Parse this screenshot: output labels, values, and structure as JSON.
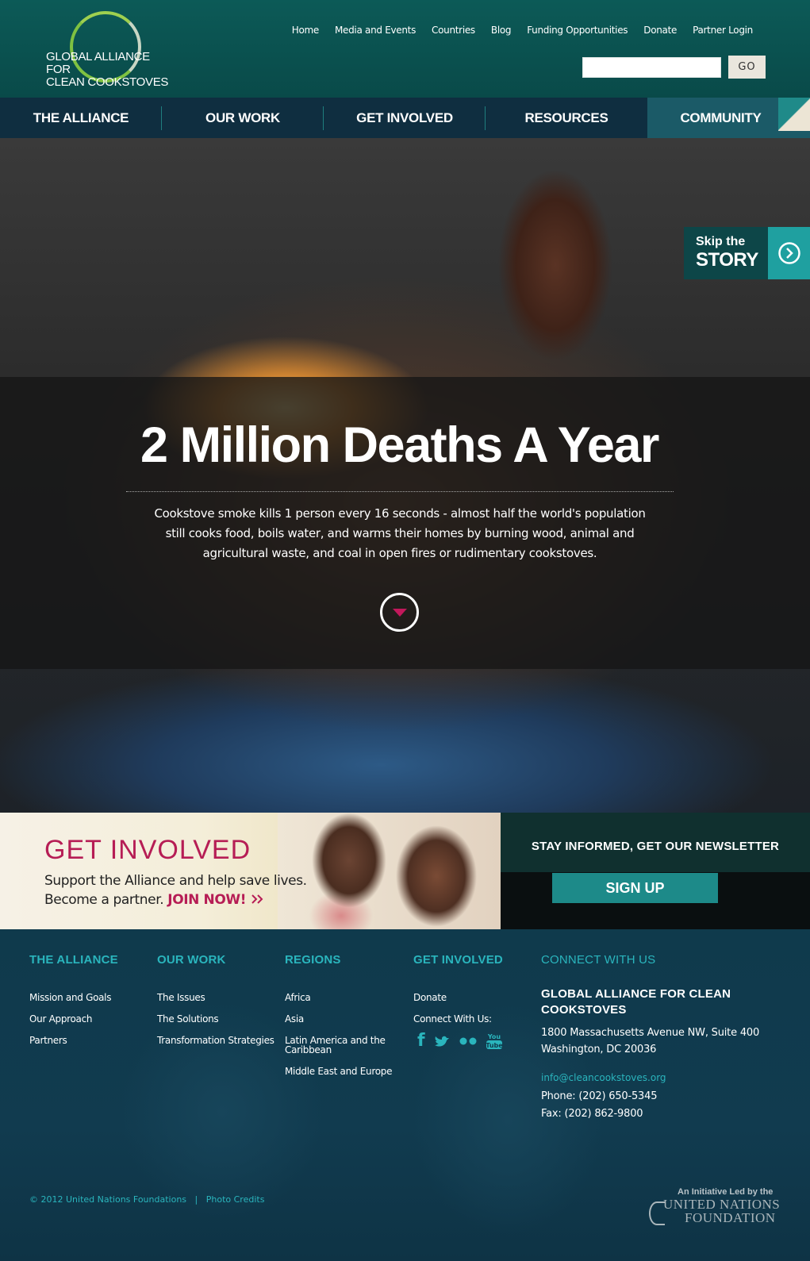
{
  "header": {
    "logo_line1": "GLOBAL ALLIANCE FOR",
    "logo_line2": "CLEAN COOKSTOVES",
    "top_nav": [
      "Home",
      "Media and Events",
      "Countries",
      "Blog",
      "Funding Opportunities",
      "Donate",
      "Partner Login"
    ],
    "search_value": "",
    "go_label": "GO"
  },
  "main_nav": [
    "THE ALLIANCE",
    "OUR WORK",
    "GET INVOLVED",
    "RESOURCES",
    "COMMUNITY"
  ],
  "hero": {
    "skip_small": "Skip the",
    "skip_big": "STORY",
    "headline": "2 Million Deaths A Year",
    "description": "Cookstove smoke kills 1 person every 16 seconds - almost half the world's population still cooks food, boils water, and warms their homes by burning wood, animal and agricultural waste, and coal in open fires or rudimentary cookstoves."
  },
  "get_involved": {
    "title": "GET INVOLVED",
    "line1": "Support the Alliance and help save lives.",
    "line2": "Become a partner.",
    "join": "JOIN NOW!"
  },
  "newsletter": {
    "title": "STAY INFORMED, GET OUR NEWSLETTER",
    "button": "SIGN UP"
  },
  "footer": {
    "alliance": {
      "heading": "THE ALLIANCE",
      "links": [
        "Mission and Goals",
        "Our Approach",
        "Partners"
      ]
    },
    "our_work": {
      "heading": "OUR WORK",
      "links": [
        "The Issues",
        "The Solutions",
        "Transformation Strategies"
      ]
    },
    "regions": {
      "heading": "REGIONS",
      "links": [
        "Africa",
        "Asia",
        "Latin America and the",
        "Caribbean",
        "Middle East and Europe"
      ]
    },
    "get_involved": {
      "heading": "GET INVOLVED",
      "links": [
        "Donate",
        "Connect With Us:"
      ]
    },
    "connect": {
      "heading": "CONNECT WITH US",
      "org_line1": "GLOBAL ALLIANCE FOR CLEAN",
      "org_line2": "COOKSTOVES",
      "address1": "1800 Massachusetts Avenue NW, Suite 400",
      "address2": "Washington, DC 20036",
      "email": "info@cleancookstoves.org",
      "phone": "Phone: (202) 650-5345",
      "fax": "Fax: (202) 862-9800"
    },
    "copyright": "© 2012 United Nations Foundations",
    "separator": "|",
    "photo_credits": "Photo Credits",
    "initiative": "An Initiative Led by the",
    "unf_line1": "UNITED NATIONS",
    "unf_line2": "FOUNDATION",
    "social_icons": [
      "facebook-icon",
      "twitter-icon",
      "flickr-icon",
      "youtube-icon"
    ],
    "social_youtube_top": "You",
    "social_youtube_bottom": "Tube"
  }
}
